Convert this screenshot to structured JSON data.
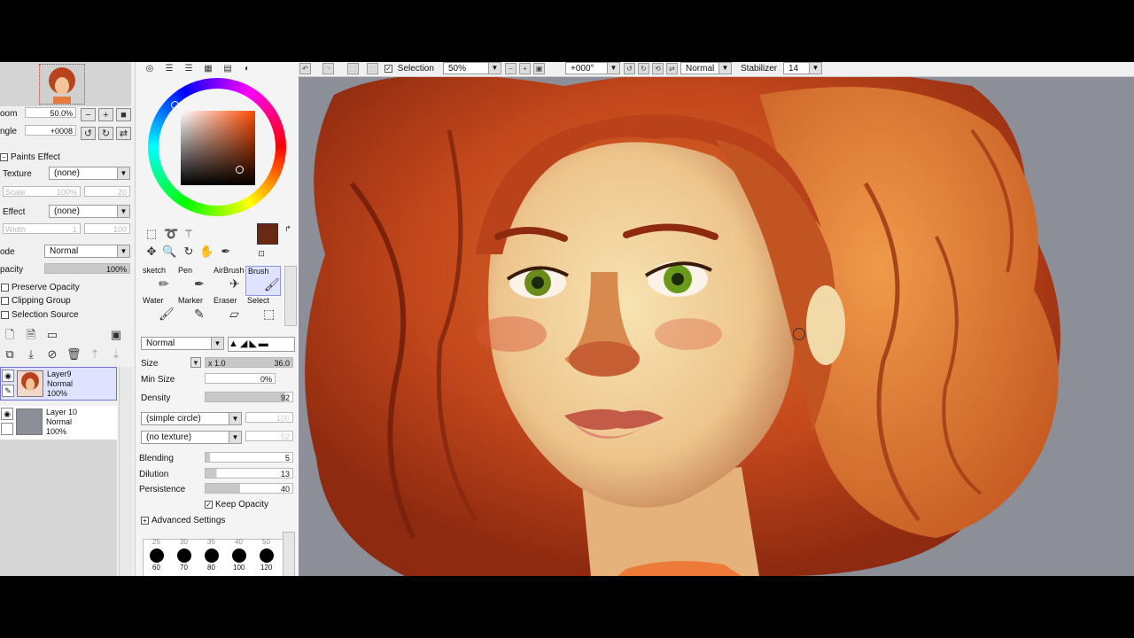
{
  "navigator": {
    "zoom_label": "oom",
    "zoom_value": "50.0%",
    "angle_label": "ngle",
    "angle_value": "+0008"
  },
  "brush_settings": {
    "paints_effect_label": "Paints Effect",
    "texture_label": "Texture",
    "texture_value": "(none)",
    "texture_scale_label": "Scale",
    "texture_scale_value": "100%",
    "texture_scale_extra": "20",
    "effect_label": "Effect",
    "effect_value": "(none)",
    "effect_width_label": "Width",
    "effect_width_value": "1",
    "effect_width_extra": "100",
    "mode_label": "ode",
    "mode_value": "Normal",
    "opacity_label": "pacity",
    "opacity_value": "100%",
    "opacity_fraction": 1.0,
    "preserve_opacity": "Preserve Opacity",
    "clipping_group": "Clipping Group",
    "selection_source": "Selection Source"
  },
  "layers": [
    {
      "name": "Layer9",
      "mode": "Normal",
      "opacity": "100%",
      "selected": true
    },
    {
      "name": "Layer 10",
      "mode": "Normal",
      "opacity": "100%",
      "selected": false
    }
  ],
  "tool_panel": {
    "brushes": [
      {
        "label": "sketch",
        "icon": "pencil-icon"
      },
      {
        "label": "Pen",
        "icon": "pen-icon"
      },
      {
        "label": "AirBrush",
        "icon": "airbrush-icon"
      },
      {
        "label": "Brush",
        "icon": "brush-icon",
        "active": true
      },
      {
        "label": "Water",
        "icon": "water-brush-icon"
      },
      {
        "label": "Marker",
        "icon": "marker-icon"
      },
      {
        "label": "Eraser",
        "icon": "eraser-icon"
      },
      {
        "label": "Select",
        "icon": "select-brush-icon"
      }
    ],
    "blend_mode": "Normal",
    "size_label": "Size",
    "size_multiplier": "x 1.0",
    "size_value": "36.0",
    "min_size_label": "Min Size",
    "min_size_value": "0%",
    "density_label": "Density",
    "density_value": "92",
    "shape_value": "(simple circle)",
    "shape_extra": "100",
    "texture_value": "(no texture)",
    "texture_extra": "52",
    "blending_label": "Blending",
    "blending_value": "5",
    "dilution_label": "Dilution",
    "dilution_value": "13",
    "persistence_label": "Persistence",
    "persistence_value": "40",
    "keep_opacity": "Keep Opacity",
    "advanced_settings": "Advanced Settings",
    "brush_sizes_row1": [
      "60",
      "70",
      "80",
      "100",
      "120"
    ],
    "brush_sizes_top": [
      "25",
      "30",
      "35",
      "40",
      "50"
    ]
  },
  "toolbar": {
    "selection_label": "Selection",
    "zoom_value": "50%",
    "rotation_value": "+000°",
    "mode_value": "Normal",
    "stabilizer_label": "Stabilizer",
    "stabilizer_value": "14"
  },
  "colors": {
    "primary": "#6a2a12",
    "secondary": "#5a4a44",
    "selected_layer": "#dfe3ff"
  }
}
